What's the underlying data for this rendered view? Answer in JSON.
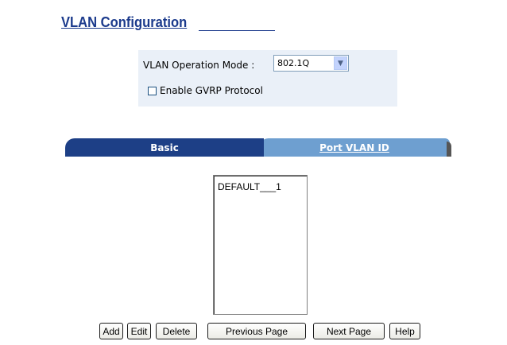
{
  "header": {
    "title": "VLAN Configuration"
  },
  "mode": {
    "label": "VLAN Operation Mode :",
    "selected": "802.1Q",
    "gvrp_label": "Enable GVRP Protocol",
    "gvrp_checked": false
  },
  "tabs": [
    {
      "label": "Basic",
      "active": true
    },
    {
      "label": "Port VLAN ID",
      "active": false
    }
  ],
  "vlan_list": {
    "items": [
      "DEFAULT___1"
    ]
  },
  "buttons": {
    "add": "Add",
    "edit": "Edit",
    "delete": "Delete",
    "previous": "Previous Page",
    "next": "Next Page",
    "help": "Help"
  },
  "colors": {
    "title": "#1b3a8c",
    "panel_bg": "#eaf0f8",
    "tab_active": "#1d3f86",
    "tab_inactive": "#6e9fd0"
  }
}
